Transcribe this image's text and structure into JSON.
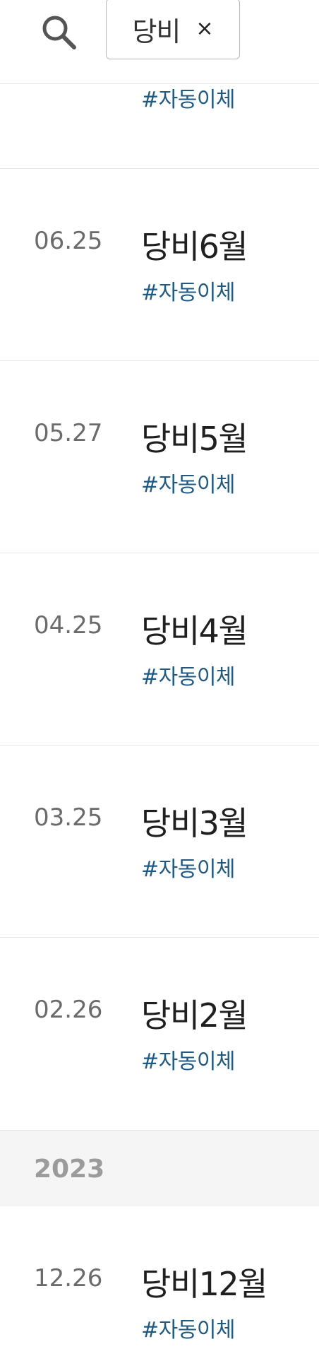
{
  "search": {
    "query": "당비",
    "clear_symbol": "×"
  },
  "top_partial": {
    "tag": "#자동이체"
  },
  "entries": [
    {
      "date": "06.25",
      "title": "당비6월",
      "tag": "#자동이체"
    },
    {
      "date": "05.27",
      "title": "당비5월",
      "tag": "#자동이체"
    },
    {
      "date": "04.25",
      "title": "당비4월",
      "tag": "#자동이체"
    },
    {
      "date": "03.25",
      "title": "당비3월",
      "tag": "#자동이체"
    },
    {
      "date": "02.26",
      "title": "당비2월",
      "tag": "#자동이체"
    }
  ],
  "year_section": {
    "year": "2023",
    "entries": [
      {
        "date": "12.26",
        "title": "당비12월",
        "tag": "#자동이체"
      }
    ]
  },
  "colors": {
    "tag": "#215a80",
    "date": "#6b6b6b",
    "title": "#1f1f1f",
    "year_bg": "#f5f5f5",
    "year_text": "#9b9b9b",
    "divider": "#e6e6e6"
  }
}
